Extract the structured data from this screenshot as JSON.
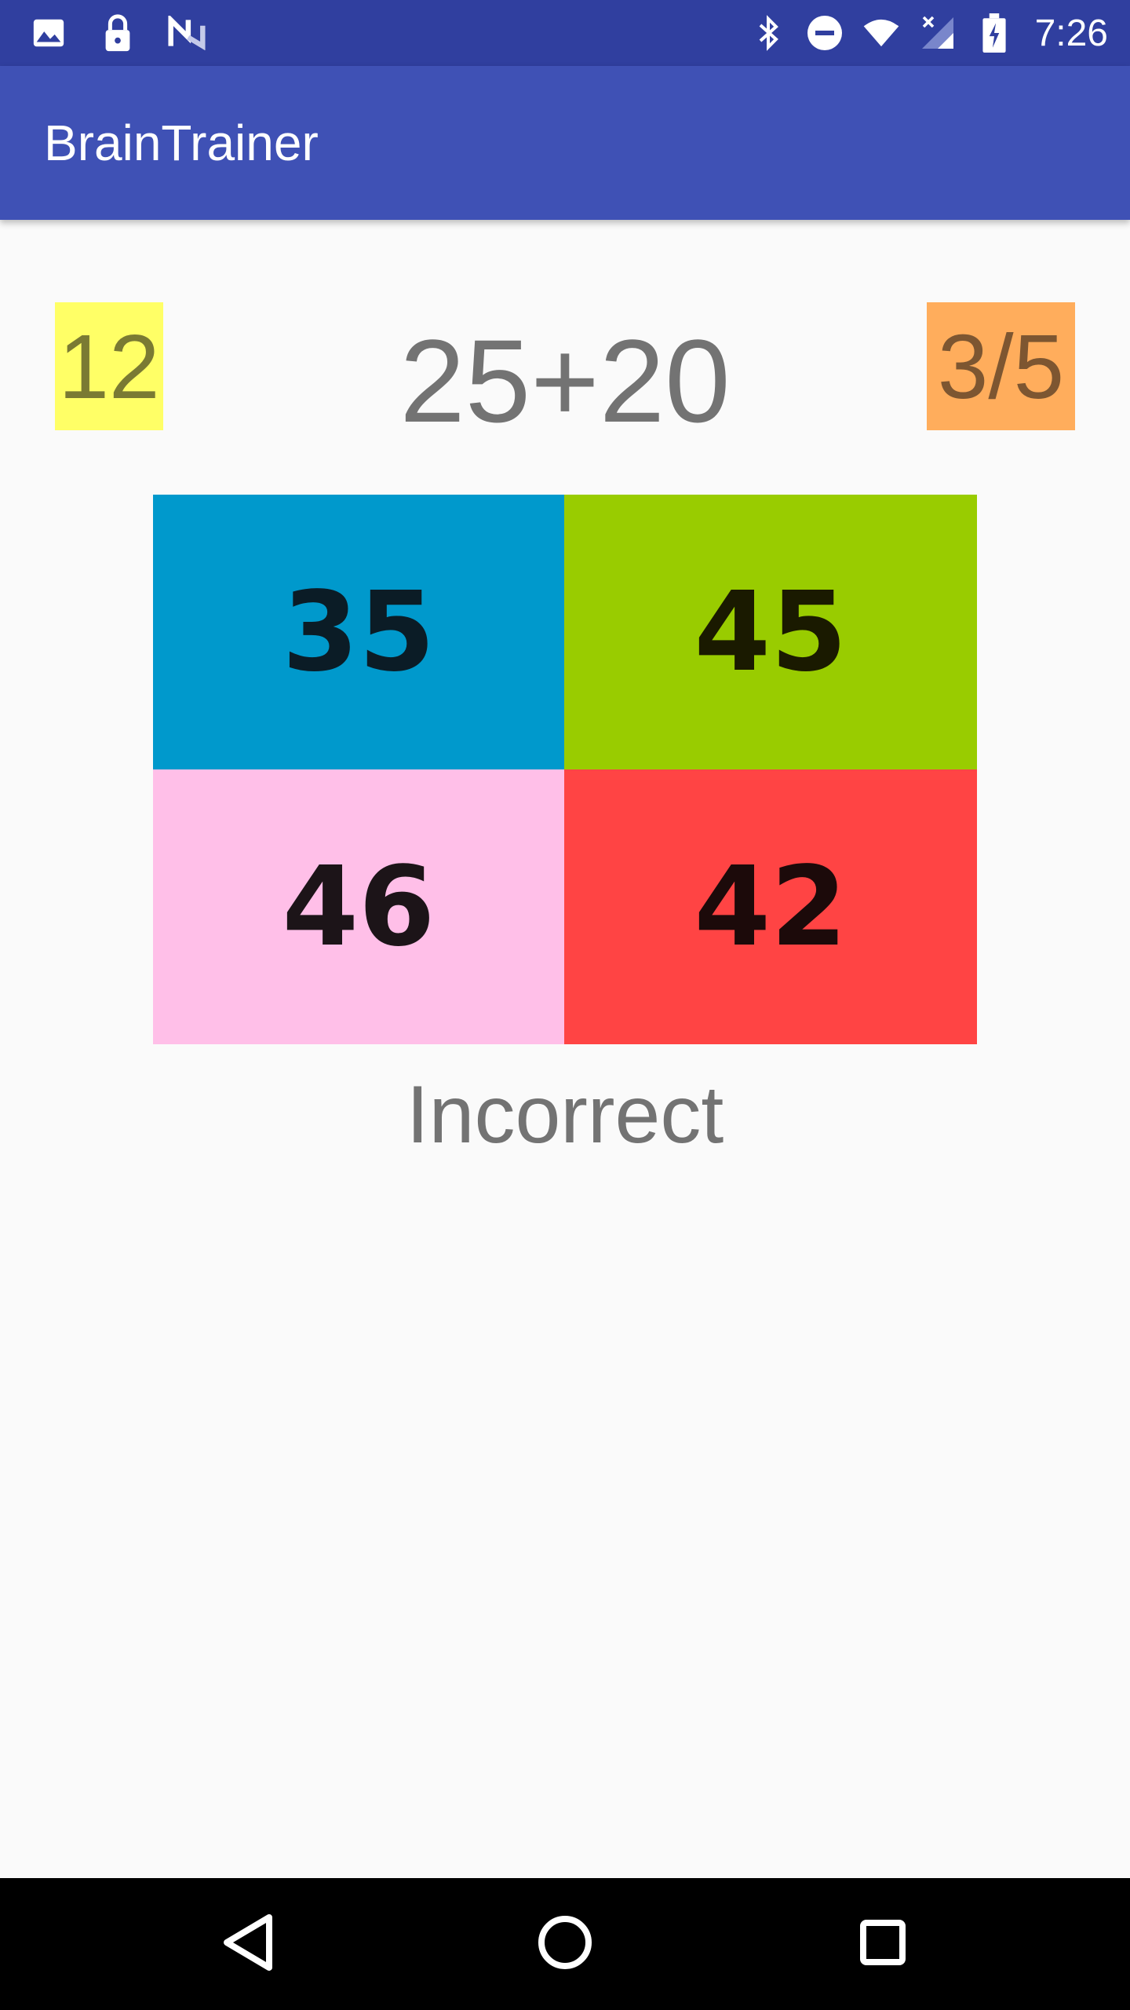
{
  "status_bar": {
    "time": "7:26",
    "left_icons": [
      "image-icon",
      "lock-icon",
      "n-logo-icon"
    ],
    "right_icons": [
      "bluetooth-icon",
      "do-not-disturb-icon",
      "wifi-icon",
      "signal-icon",
      "battery-icon"
    ]
  },
  "app_bar": {
    "title": "BrainTrainer"
  },
  "game": {
    "timer": "12",
    "question": "25+20",
    "score": "3/5",
    "answers": [
      "35",
      "45",
      "46",
      "42"
    ],
    "result": "Incorrect"
  },
  "colors": {
    "status_bar": "#303f9f",
    "app_bar": "#3f51b5",
    "timer_bg": "#ffff66",
    "score_bg": "#ffad5c",
    "answer_1": "#0099cc",
    "answer_2": "#99cc00",
    "answer_3": "#ffbfe8",
    "answer_4": "#ff4444"
  },
  "nav_bar": {
    "buttons": [
      "back-icon",
      "home-icon",
      "recents-icon"
    ]
  }
}
